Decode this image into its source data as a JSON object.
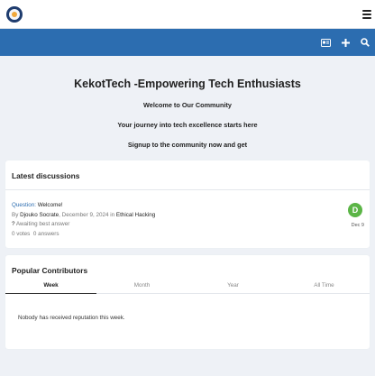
{
  "topbar": {
    "logo_icon": "site-logo",
    "menu_icon": "hamburger-menu-icon"
  },
  "navbar": {
    "icons": [
      "id-card-icon",
      "plus-icon",
      "search-icon"
    ],
    "accent": "#2c6db0"
  },
  "hero": {
    "title": "KekotTech -Empowering Tech Enthusiasts",
    "line1": "Welcome to Our Community",
    "line2": "Your journey into tech excellence starts here",
    "line3": "Signup to the community now and get"
  },
  "discussions": {
    "title": "Latest discussions",
    "items": [
      {
        "type_label": "Question:",
        "title": "Welcome!",
        "by": "By",
        "author": "Djouko Socrate",
        "date_full": ", December 9, 2024 in",
        "forum": "Ethical Hacking",
        "status_mark": "?",
        "status": "Awaiting best answer",
        "votes": "0 votes",
        "answers": "0 answers",
        "avatar_letter": "D",
        "avatar_color": "#5bb546",
        "date_short": "Dec 9"
      }
    ]
  },
  "contributors": {
    "title": "Popular Contributors",
    "tabs": [
      "Week",
      "Month",
      "Year",
      "All Time"
    ],
    "active_tab": "Week",
    "empty_message": "Nobody has received reputation this week."
  }
}
